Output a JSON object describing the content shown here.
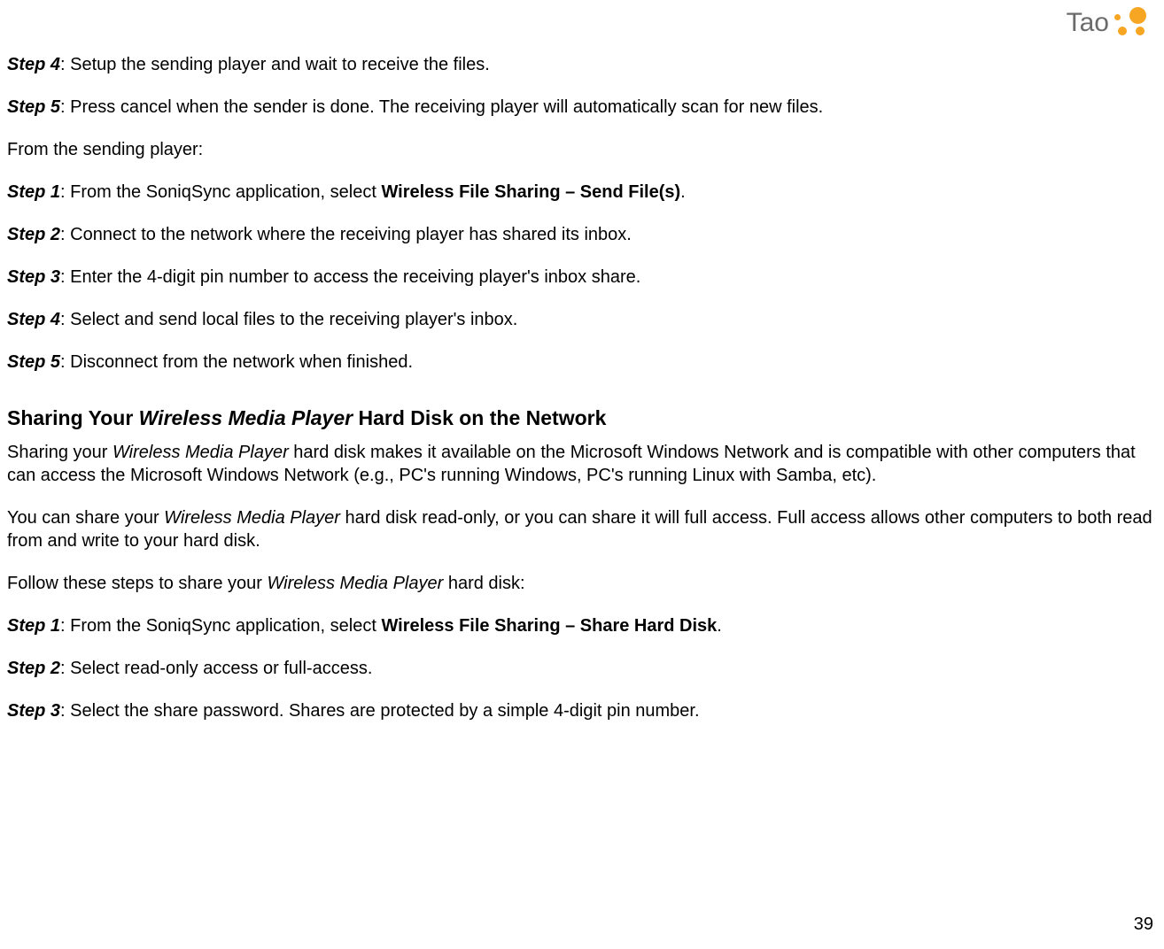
{
  "logo": {
    "text": "Tao"
  },
  "top_steps": [
    {
      "label": "Step 4",
      "text": ": Setup the sending player and wait to receive the files."
    },
    {
      "label": "Step 5",
      "text": ": Press cancel when the sender is done.  The receiving player will automatically scan for new files."
    }
  ],
  "from_sending": "From the sending player:",
  "sending_steps": [
    {
      "label": "Step 1",
      "pre": ": From the SoniqSync application, select ",
      "bold": "Wireless File Sharing – Send File(s)",
      "post": "."
    },
    {
      "label": "Step 2",
      "text": ": Connect to the network where the receiving player has shared its inbox."
    },
    {
      "label": "Step 3",
      "text": ": Enter the 4-digit pin number to access the receiving player's inbox share."
    },
    {
      "label": "Step 4",
      "text": ": Select and send local files to the receiving player's inbox."
    },
    {
      "label": "Step 5",
      "text": ": Disconnect from the network when finished."
    }
  ],
  "section_heading": {
    "pre": "Sharing Your ",
    "ital": "Wireless Media Player",
    "post": " Hard Disk on the Network"
  },
  "section_paras": [
    {
      "runs": [
        {
          "t": "Sharing your "
        },
        {
          "t": "Wireless Media Player",
          "ital": true
        },
        {
          "t": " hard disk makes it available on the Microsoft Windows Network and is compatible with other computers that can access the Microsoft Windows Network (e.g., PC's running Windows, PC's running Linux with Samba, etc)."
        }
      ]
    },
    {
      "runs": [
        {
          "t": "You can share your "
        },
        {
          "t": "Wireless Media Player",
          "ital": true
        },
        {
          "t": " hard disk read-only, or you can share it will full access.  Full access allows other computers to both read from and write to your hard disk."
        }
      ]
    },
    {
      "runs": [
        {
          "t": "Follow these steps to share your "
        },
        {
          "t": "Wireless Media Player",
          "ital": true
        },
        {
          "t": " hard disk:"
        }
      ]
    }
  ],
  "share_steps": [
    {
      "label": "Step 1",
      "pre": ": From the SoniqSync application, select ",
      "bold": "Wireless File Sharing – Share Hard Disk",
      "post": "."
    },
    {
      "label": "Step 2",
      "text": ": Select read-only access or full-access."
    },
    {
      "label": "Step 3",
      "text": ": Select the share password. Shares are protected by a simple 4-digit pin number."
    }
  ],
  "page_number": "39"
}
